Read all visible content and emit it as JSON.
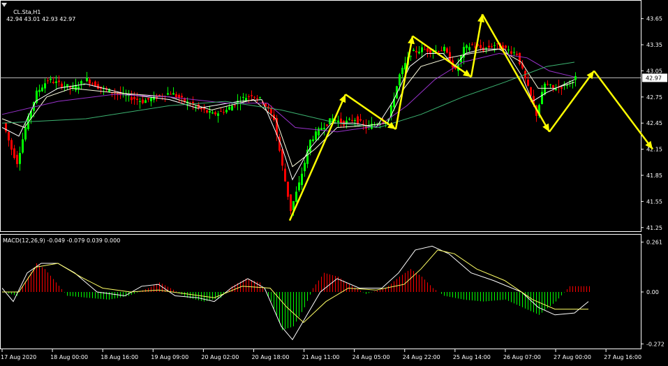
{
  "main_header": {
    "symbol": "CL.Sta,H1",
    "ohlc": "42.94 43.01 42.93 42.97"
  },
  "macd_header": {
    "label": "MACD(12,26,9) -0.049 -0.079 0.039 0.000"
  },
  "colors": {
    "background": "#000000",
    "bull": "#00ff00",
    "bear": "#ff0000",
    "axis": "#ffffff",
    "bid_line": "#c0c0c0",
    "ma_fast": "#ffffff",
    "ma_mid": "#ffffe0",
    "ma_slow": "#9932cc",
    "ma_long": "#3cb371",
    "arrows": "#ffff00",
    "macd_line": "#ffffff",
    "signal_line": "#ffff66"
  },
  "chart_data": [
    {
      "type": "candlestick",
      "panel": "price",
      "symbol": "CL.Sta",
      "timeframe": "H1",
      "ylim": [
        41.2,
        43.8
      ],
      "y_ticks": [
        "43.65",
        "43.35",
        "43.05",
        "42.75",
        "42.45",
        "42.15",
        "41.85",
        "41.55",
        "41.25"
      ],
      "current_price": "42.97",
      "x_ticks": [
        "17 Aug 2020",
        "18 Aug 00:00",
        "18 Aug 16:00",
        "19 Aug 09:00",
        "20 Aug 02:00",
        "20 Aug 18:00",
        "21 Aug 11:00",
        "24 Aug 05:00",
        "24 Aug 22:00",
        "25 Aug 14:00",
        "26 Aug 07:00",
        "27 Aug 00:00",
        "27 Aug 16:00"
      ],
      "price_path": [
        [
          0,
          42.45
        ],
        [
          3,
          42.15
        ],
        [
          5,
          42.0
        ],
        [
          8,
          42.4
        ],
        [
          12,
          42.8
        ],
        [
          16,
          42.95
        ],
        [
          20,
          42.9
        ],
        [
          25,
          42.85
        ],
        [
          30,
          42.95
        ],
        [
          35,
          42.85
        ],
        [
          40,
          42.8
        ],
        [
          45,
          42.75
        ],
        [
          50,
          42.7
        ],
        [
          55,
          42.75
        ],
        [
          60,
          42.8
        ],
        [
          65,
          42.7
        ],
        [
          70,
          42.62
        ],
        [
          75,
          42.55
        ],
        [
          80,
          42.6
        ],
        [
          85,
          42.72
        ],
        [
          89,
          42.78
        ],
        [
          93,
          42.7
        ],
        [
          97,
          42.5
        ],
        [
          100,
          41.95
        ],
        [
          103,
          41.45
        ],
        [
          106,
          41.75
        ],
        [
          110,
          42.25
        ],
        [
          114,
          42.4
        ],
        [
          118,
          42.5
        ],
        [
          122,
          42.45
        ],
        [
          126,
          42.5
        ],
        [
          130,
          42.4
        ],
        [
          134,
          42.45
        ],
        [
          138,
          42.5
        ],
        [
          142,
          43.0
        ],
        [
          146,
          43.25
        ],
        [
          150,
          43.3
        ],
        [
          154,
          43.28
        ],
        [
          158,
          43.3
        ],
        [
          162,
          43.05
        ],
        [
          165,
          43.3
        ],
        [
          168,
          43.35
        ],
        [
          172,
          43.3
        ],
        [
          176,
          43.35
        ],
        [
          180,
          43.3
        ],
        [
          184,
          43.25
        ],
        [
          188,
          42.85
        ],
        [
          191,
          42.55
        ],
        [
          194,
          42.9
        ],
        [
          197,
          42.85
        ],
        [
          201,
          42.88
        ],
        [
          205,
          42.97
        ]
      ],
      "moving_averages": [
        {
          "name": "fast",
          "color": "#ffffff",
          "points": [
            [
              0,
              42.4
            ],
            [
              6,
              42.3
            ],
            [
              12,
              42.7
            ],
            [
              20,
              42.85
            ],
            [
              30,
              42.9
            ],
            [
              45,
              42.78
            ],
            [
              60,
              42.72
            ],
            [
              70,
              42.62
            ],
            [
              85,
              42.7
            ],
            [
              93,
              42.72
            ],
            [
              100,
              42.2
            ],
            [
              104,
              41.8
            ],
            [
              110,
              42.15
            ],
            [
              118,
              42.45
            ],
            [
              126,
              42.45
            ],
            [
              134,
              42.4
            ],
            [
              140,
              42.7
            ],
            [
              146,
              43.1
            ],
            [
              152,
              43.25
            ],
            [
              158,
              43.25
            ],
            [
              162,
              43.1
            ],
            [
              166,
              43.25
            ],
            [
              172,
              43.3
            ],
            [
              180,
              43.3
            ],
            [
              186,
              43.0
            ],
            [
              190,
              42.7
            ],
            [
              195,
              42.8
            ],
            [
              205,
              42.95
            ]
          ]
        },
        {
          "name": "mid",
          "color": "#ffffe0",
          "points": [
            [
              0,
              42.5
            ],
            [
              8,
              42.4
            ],
            [
              16,
              42.75
            ],
            [
              25,
              42.85
            ],
            [
              40,
              42.8
            ],
            [
              60,
              42.75
            ],
            [
              75,
              42.6
            ],
            [
              90,
              42.72
            ],
            [
              98,
              42.5
            ],
            [
              104,
              41.95
            ],
            [
              112,
              42.15
            ],
            [
              120,
              42.4
            ],
            [
              130,
              42.42
            ],
            [
              138,
              42.45
            ],
            [
              144,
              42.85
            ],
            [
              150,
              43.1
            ],
            [
              160,
              43.2
            ],
            [
              168,
              43.25
            ],
            [
              178,
              43.3
            ],
            [
              186,
              43.15
            ],
            [
              192,
              42.85
            ],
            [
              198,
              42.85
            ],
            [
              205,
              42.92
            ]
          ]
        },
        {
          "name": "slow",
          "color": "#9932cc",
          "points": [
            [
              0,
              42.55
            ],
            [
              20,
              42.7
            ],
            [
              40,
              42.78
            ],
            [
              60,
              42.75
            ],
            [
              80,
              42.68
            ],
            [
              95,
              42.68
            ],
            [
              105,
              42.4
            ],
            [
              120,
              42.35
            ],
            [
              135,
              42.42
            ],
            [
              145,
              42.65
            ],
            [
              155,
              42.95
            ],
            [
              165,
              43.15
            ],
            [
              178,
              43.25
            ],
            [
              188,
              43.2
            ],
            [
              196,
              43.05
            ],
            [
              205,
              42.98
            ]
          ]
        },
        {
          "name": "long",
          "color": "#3cb371",
          "points": [
            [
              0,
              42.45
            ],
            [
              30,
              42.5
            ],
            [
              60,
              42.65
            ],
            [
              80,
              42.7
            ],
            [
              100,
              42.6
            ],
            [
              120,
              42.45
            ],
            [
              135,
              42.4
            ],
            [
              150,
              42.55
            ],
            [
              165,
              42.75
            ],
            [
              180,
              42.92
            ],
            [
              195,
              43.1
            ],
            [
              205,
              43.15
            ]
          ]
        }
      ],
      "arrows": [
        [
          [
            103,
            41.33
          ],
          [
            123,
            42.78
          ]
        ],
        [
          [
            123,
            42.78
          ],
          [
            141,
            42.38
          ]
        ],
        [
          [
            141,
            42.38
          ],
          [
            147,
            43.45
          ]
        ],
        [
          [
            147,
            43.45
          ],
          [
            168,
            42.98
          ]
        ],
        [
          [
            168,
            42.98
          ],
          [
            172,
            43.7
          ]
        ],
        [
          [
            172,
            43.7
          ],
          [
            196,
            42.35
          ]
        ],
        [
          [
            196,
            42.35
          ],
          [
            212,
            43.05
          ]
        ],
        [
          [
            212,
            43.05
          ],
          [
            233,
            42.15
          ]
        ]
      ]
    },
    {
      "type": "bar+line",
      "panel": "macd",
      "name": "MACD(12,26,9)",
      "ylim": [
        -0.3,
        0.3
      ],
      "y_ticks": [
        "0.261",
        "0.00",
        "-0.272"
      ],
      "histogram": [
        [
          0,
          0.0
        ],
        [
          5,
          -0.02
        ],
        [
          9,
          0.08
        ],
        [
          12,
          0.15
        ],
        [
          15,
          0.12
        ],
        [
          19,
          0.05
        ],
        [
          23,
          -0.02
        ],
        [
          30,
          -0.03
        ],
        [
          38,
          -0.04
        ],
        [
          45,
          -0.02
        ],
        [
          52,
          0.02
        ],
        [
          56,
          0.05
        ],
        [
          60,
          0.02
        ],
        [
          66,
          -0.03
        ],
        [
          72,
          -0.05
        ],
        [
          78,
          -0.03
        ],
        [
          82,
          0.03
        ],
        [
          87,
          0.07
        ],
        [
          92,
          0.05
        ],
        [
          96,
          -0.05
        ],
        [
          100,
          -0.2
        ],
        [
          104,
          -0.18
        ],
        [
          108,
          -0.08
        ],
        [
          111,
          0.02
        ],
        [
          115,
          0.1
        ],
        [
          120,
          0.08
        ],
        [
          124,
          0.04
        ],
        [
          130,
          -0.01
        ],
        [
          137,
          0.02
        ],
        [
          142,
          0.08
        ],
        [
          146,
          0.12
        ],
        [
          150,
          0.08
        ],
        [
          154,
          0.02
        ],
        [
          158,
          -0.02
        ],
        [
          165,
          -0.04
        ],
        [
          172,
          -0.05
        ],
        [
          180,
          -0.04
        ],
        [
          186,
          -0.08
        ],
        [
          192,
          -0.12
        ],
        [
          198,
          -0.05
        ],
        [
          203,
          0.03
        ],
        [
          210,
          0.03
        ]
      ],
      "macd_line": [
        [
          0,
          0.02
        ],
        [
          4,
          -0.05
        ],
        [
          9,
          0.1
        ],
        [
          14,
          0.15
        ],
        [
          20,
          0.15
        ],
        [
          26,
          0.1
        ],
        [
          34,
          0.0
        ],
        [
          44,
          -0.02
        ],
        [
          50,
          0.03
        ],
        [
          56,
          0.04
        ],
        [
          62,
          -0.02
        ],
        [
          70,
          -0.03
        ],
        [
          76,
          -0.05
        ],
        [
          82,
          0.02
        ],
        [
          88,
          0.07
        ],
        [
          94,
          0.02
        ],
        [
          100,
          -0.18
        ],
        [
          104,
          -0.25
        ],
        [
          108,
          -0.15
        ],
        [
          114,
          0.0
        ],
        [
          120,
          0.07
        ],
        [
          128,
          0.02
        ],
        [
          136,
          0.02
        ],
        [
          142,
          0.1
        ],
        [
          148,
          0.22
        ],
        [
          154,
          0.24
        ],
        [
          160,
          0.2
        ],
        [
          168,
          0.1
        ],
        [
          176,
          0.06
        ],
        [
          186,
          0.0
        ],
        [
          192,
          -0.08
        ],
        [
          198,
          -0.12
        ],
        [
          205,
          -0.11
        ],
        [
          210,
          -0.05
        ]
      ],
      "signal_line": [
        [
          0,
          0.0
        ],
        [
          6,
          0.0
        ],
        [
          12,
          0.13
        ],
        [
          20,
          0.15
        ],
        [
          28,
          0.08
        ],
        [
          36,
          0.02
        ],
        [
          46,
          0.0
        ],
        [
          56,
          0.01
        ],
        [
          66,
          -0.01
        ],
        [
          76,
          -0.03
        ],
        [
          86,
          0.03
        ],
        [
          96,
          0.02
        ],
        [
          102,
          -0.08
        ],
        [
          108,
          -0.16
        ],
        [
          116,
          -0.05
        ],
        [
          124,
          0.02
        ],
        [
          134,
          0.01
        ],
        [
          144,
          0.04
        ],
        [
          150,
          0.12
        ],
        [
          156,
          0.22
        ],
        [
          162,
          0.2
        ],
        [
          170,
          0.12
        ],
        [
          180,
          0.06
        ],
        [
          190,
          -0.04
        ],
        [
          198,
          -0.09
        ],
        [
          210,
          -0.09
        ]
      ]
    }
  ]
}
